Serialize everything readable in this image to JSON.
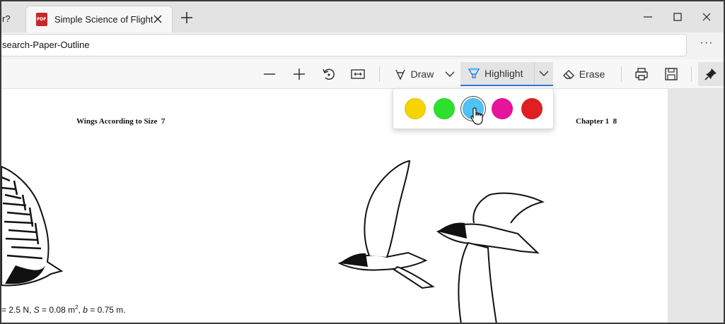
{
  "browser": {
    "prev_tab_fragment": "r?",
    "active_tab": {
      "title": "Simple Science of Flight",
      "icon": "pdf-file-icon"
    },
    "address": "search-Paper-Outline",
    "more_label": "···"
  },
  "toolbar": {
    "draw_label": "Draw",
    "highlight_label": "Highlight",
    "erase_label": "Erase"
  },
  "highlight_colors": [
    {
      "name": "yellow",
      "color": "#F5D400"
    },
    {
      "name": "green",
      "color": "#2EE02E"
    },
    {
      "name": "light-blue",
      "color": "#4FC3F7",
      "selected": true
    },
    {
      "name": "pink",
      "color": "#E5149B"
    },
    {
      "name": "red",
      "color": "#E02020"
    }
  ],
  "document": {
    "header_left": "Wings According to Size",
    "header_left_page": "7",
    "header_right": "Chapter 1",
    "header_right_page": "8",
    "caption_part1": "= 2.5 N, ",
    "caption_s": "S",
    "caption_part2": " = 0.08 m",
    "caption_sup": "2",
    "caption_part3": ", ",
    "caption_b": "b",
    "caption_part4": " = 0.75 m."
  },
  "colors": {
    "accent": "#2F79D6",
    "tab_strip": "#E3E3E3",
    "page_bg": "#FFFFFF"
  }
}
